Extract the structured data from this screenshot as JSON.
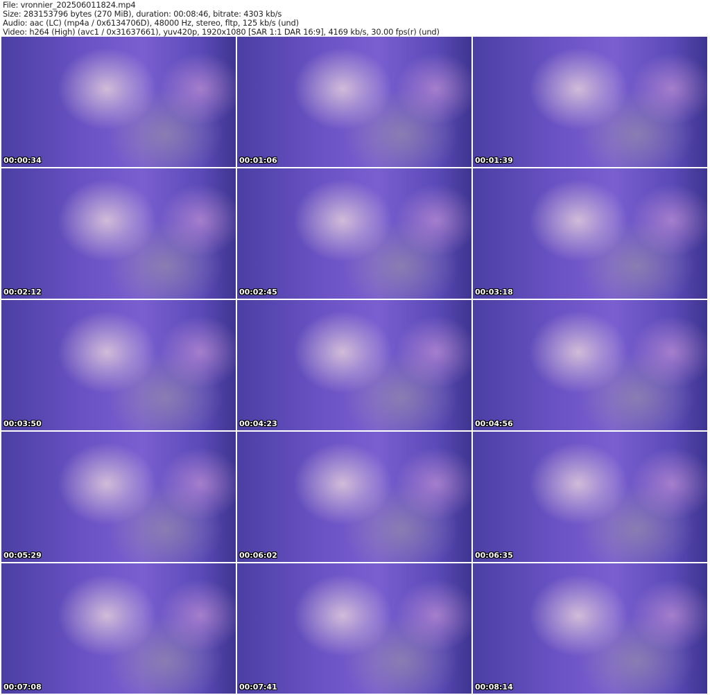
{
  "header": {
    "file": "File: vronnier_202506011824.mp4",
    "size": "Size: 283153796 bytes (270 MiB), duration: 00:08:46, bitrate: 4303 kb/s",
    "audio": "Audio: aac (LC) (mp4a / 0x6134706D), 48000 Hz, stereo, fltp, 125 kb/s (und)",
    "video": "Video: h264 (High) (avc1 / 0x31637661), yuv420p, 1920x1080 [SAR 1:1 DAR 16:9], 4169 kb/s, 30.00 fps(r) (und)"
  },
  "thumbnails": [
    {
      "timestamp": "00:00:34"
    },
    {
      "timestamp": "00:01:06"
    },
    {
      "timestamp": "00:01:39"
    },
    {
      "timestamp": "00:02:12"
    },
    {
      "timestamp": "00:02:45"
    },
    {
      "timestamp": "00:03:18"
    },
    {
      "timestamp": "00:03:50"
    },
    {
      "timestamp": "00:04:23"
    },
    {
      "timestamp": "00:04:56"
    },
    {
      "timestamp": "00:05:29"
    },
    {
      "timestamp": "00:06:02"
    },
    {
      "timestamp": "00:06:35"
    },
    {
      "timestamp": "00:07:08"
    },
    {
      "timestamp": "00:07:41"
    },
    {
      "timestamp": "00:08:14"
    }
  ]
}
